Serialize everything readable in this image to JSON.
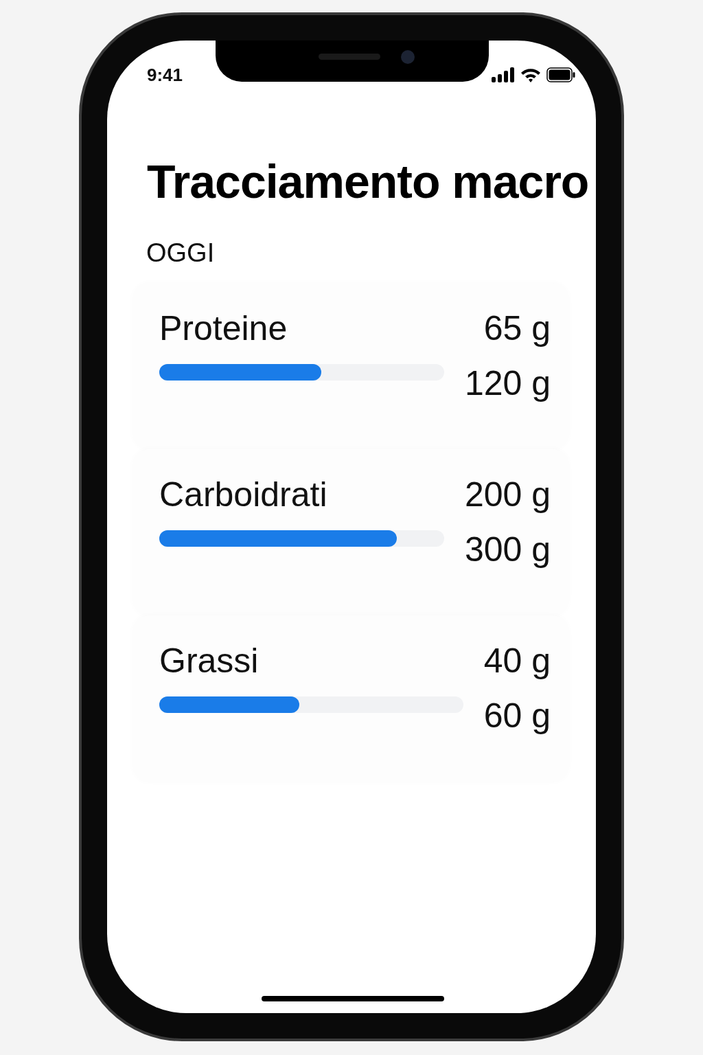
{
  "status_bar": {
    "time": "9:41"
  },
  "title": "Tracciamento macro",
  "section": "OGGI",
  "macros": [
    {
      "name": "Proteine",
      "amount": "65 g",
      "goal": "120 g",
      "level": 0.57
    },
    {
      "name": "Carboidrati",
      "amount": "200 g",
      "goal": "300 g",
      "level": 0.835
    },
    {
      "name": "Grassi",
      "amount": "40 g",
      "goal": "60 g",
      "level": 0.46
    }
  ]
}
